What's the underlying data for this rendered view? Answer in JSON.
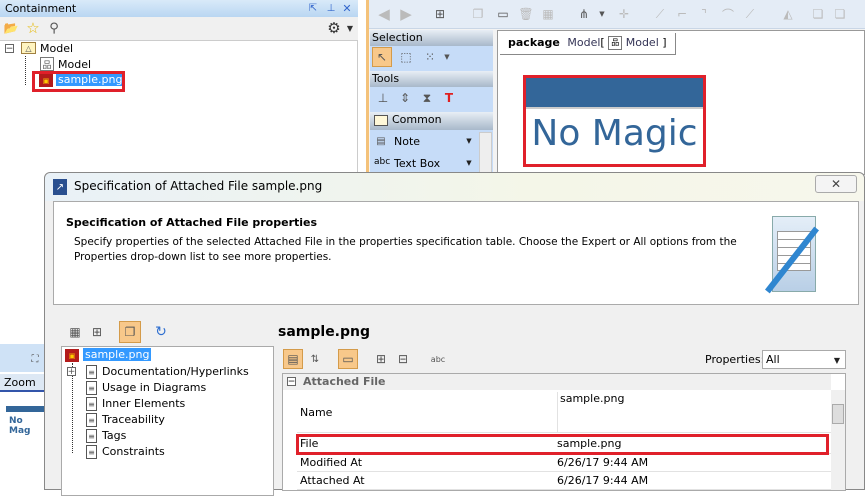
{
  "containment": {
    "title": "Containment",
    "tree": [
      {
        "label": "Model"
      },
      {
        "label": "Model"
      },
      {
        "label": "sample.png"
      }
    ]
  },
  "palette": {
    "selection": "Selection",
    "tools": "Tools",
    "common": "Common",
    "note": "Note",
    "textbox": "Text Box"
  },
  "diagram": {
    "kind": "package",
    "name": "Model",
    "bracket_open": "[",
    "bracket_close": "]",
    "diagram_name": "Model",
    "image_text": "No Magic"
  },
  "zoom_panel": {
    "label": "Zoom",
    "preview_text": "No Mag"
  },
  "dialog": {
    "title": "Specification of Attached File sample.png",
    "header_title": "Specification of Attached File properties",
    "header_desc": "Specify properties of the selected Attached File in the properties specification table. Choose the Expert or All options from the Properties drop-down list to see more properties.",
    "element_title": "sample.png",
    "tree": [
      "sample.png",
      "Documentation/Hyperlinks",
      "Usage in Diagrams",
      "Inner Elements",
      "Traceability",
      "Tags",
      "Constraints"
    ],
    "properties_label": "Properties:",
    "properties_value": "All",
    "group": "Attached File",
    "rows": [
      {
        "key": "Name",
        "value": "sample.png"
      },
      {
        "key": "File",
        "value": "sample.png"
      },
      {
        "key": "Modified At",
        "value": "6/26/17 9:44 AM"
      },
      {
        "key": "Attached At",
        "value": "6/26/17 9:44 AM"
      }
    ]
  }
}
